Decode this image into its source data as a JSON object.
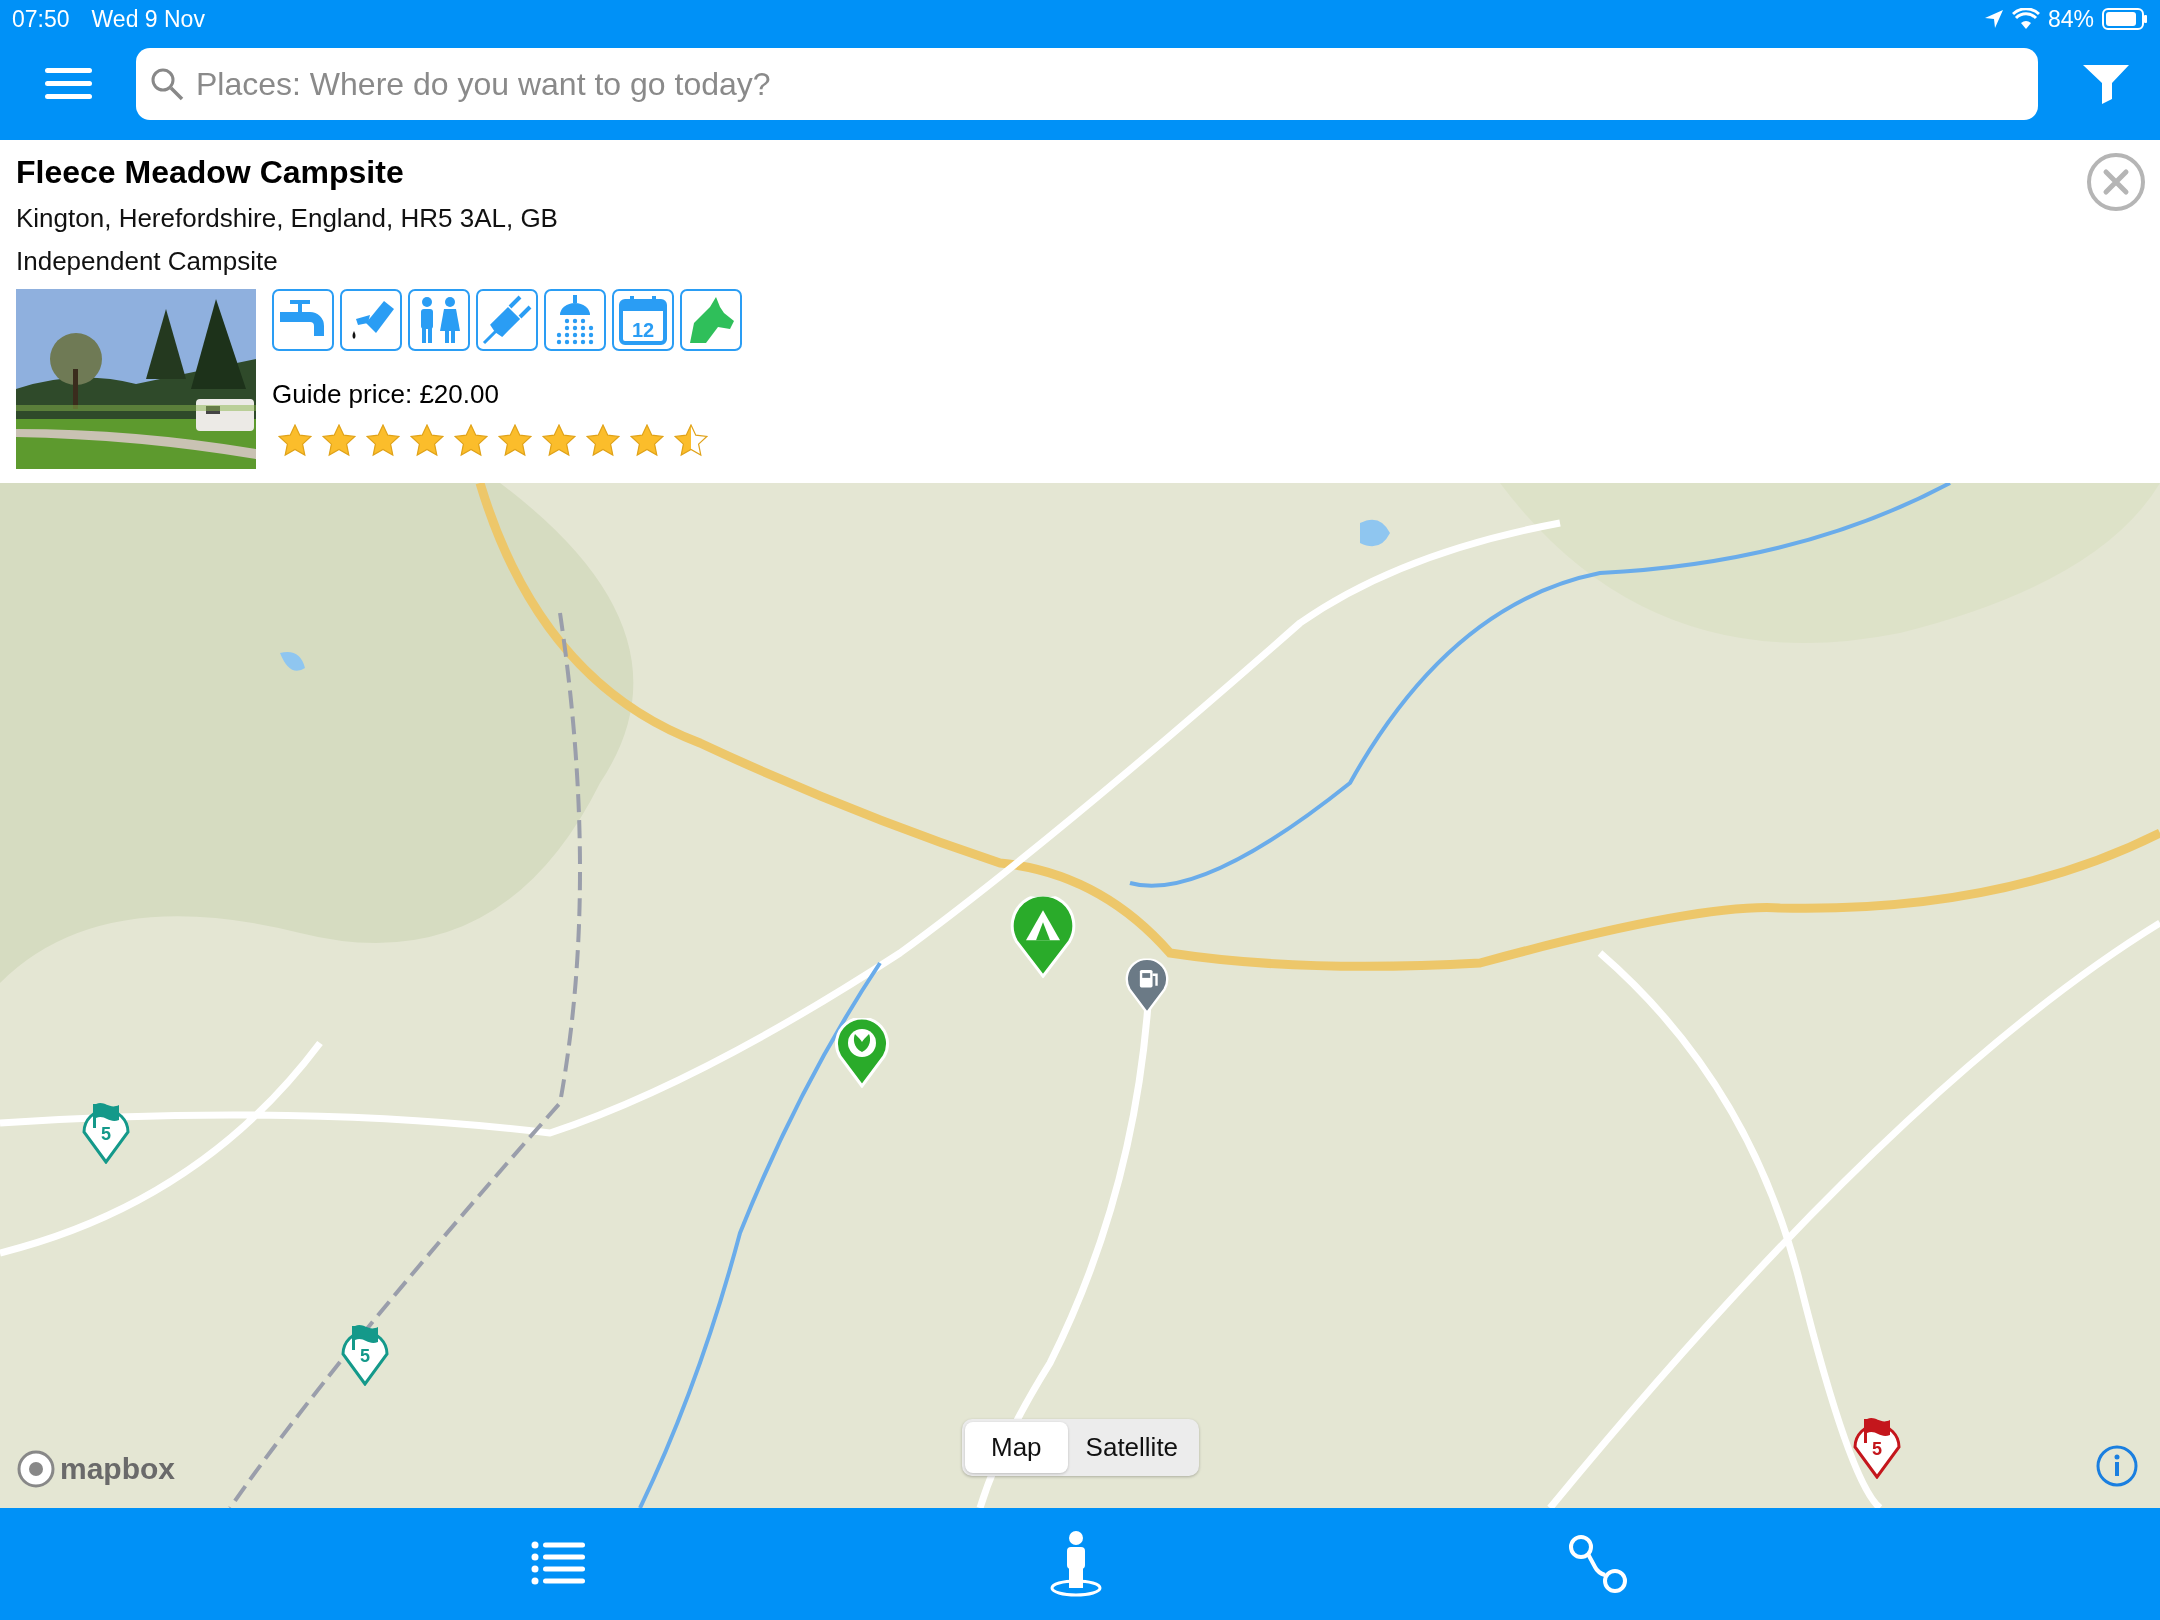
{
  "status_bar": {
    "time": "07:50",
    "date": "Wed 9 Nov",
    "battery": "84%"
  },
  "search": {
    "placeholder": "Places: Where do you want to go today?"
  },
  "place": {
    "name": "Fleece Meadow Campsite",
    "address": "Kington, Herefordshire, England, HR5 3AL, GB",
    "type": "Independent Campsite",
    "price": "Guide price: £20.00",
    "stars": 9.5,
    "amenities": [
      {
        "kind": "tap"
      },
      {
        "kind": "waste"
      },
      {
        "kind": "toilets"
      },
      {
        "kind": "hookup"
      },
      {
        "kind": "shower"
      },
      {
        "kind": "calendar",
        "text": "12"
      },
      {
        "kind": "dog"
      }
    ]
  },
  "map": {
    "pins": [
      {
        "kind": "campsite",
        "color": "#2aab2a"
      },
      {
        "kind": "fuel",
        "color": "#6b7a86"
      },
      {
        "kind": "garden",
        "color": "#2aab2a"
      },
      {
        "kind": "flag",
        "color": "#14998a",
        "text": "5"
      },
      {
        "kind": "flag",
        "color": "#14998a",
        "text": "5"
      },
      {
        "kind": "flag",
        "color": "#c4161c",
        "text": "5"
      }
    ],
    "attribution": "mapbox",
    "toggle": [
      {
        "label": "Map",
        "selected": true
      },
      {
        "label": "Satellite",
        "selected": false
      }
    ]
  },
  "bottom_bar": [
    {
      "kind": "list"
    },
    {
      "kind": "person"
    },
    {
      "kind": "route"
    }
  ]
}
